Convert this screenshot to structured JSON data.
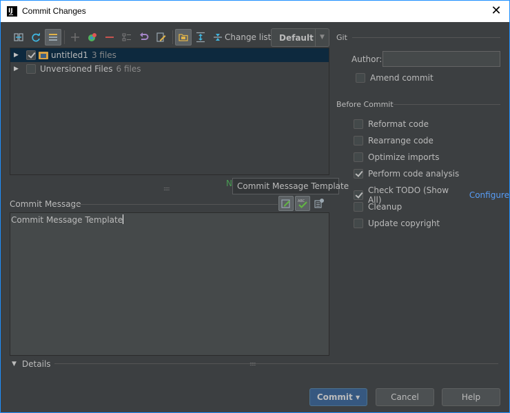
{
  "window": {
    "title": "Commit Changes",
    "app_icon": "intellij-icon",
    "close_icon": "close-icon"
  },
  "toolbar": {
    "buttons": [
      {
        "icon": "show-diff-icon"
      },
      {
        "icon": "refresh-icon"
      },
      {
        "icon": "group-by-directory-icon",
        "active": true
      },
      {
        "icon": "add-icon"
      },
      {
        "icon": "move-to-changelist-icon"
      },
      {
        "icon": "remove-icon"
      },
      {
        "icon": "shelve-icon"
      },
      {
        "icon": "rollback-icon"
      },
      {
        "icon": "edit-source-icon"
      },
      {
        "icon": "show-directories-icon",
        "active": true
      },
      {
        "icon": "expand-all-icon"
      },
      {
        "icon": "collapse-all-icon"
      }
    ],
    "changelist_label": "Change list:",
    "changelist_value": "Default"
  },
  "tree": {
    "rows": [
      {
        "name": "untitled1",
        "count": "3 files",
        "checked": true,
        "selected": true,
        "folder": true
      },
      {
        "name": "Unversioned Files",
        "count": "6 files",
        "checked": false,
        "selected": false,
        "folder": false
      }
    ]
  },
  "status_fragment": "N",
  "tooltip": "Commit Message Template",
  "commit_message": {
    "label": "Commit Message",
    "value": "Commit Message Template",
    "tools": [
      {
        "icon": "message-template-icon",
        "pressed": true
      },
      {
        "icon": "spellcheck-icon",
        "pressed": true
      },
      {
        "icon": "commit-history-icon",
        "pressed": false
      }
    ]
  },
  "details_label": "Details",
  "git": {
    "section_title": "Git",
    "author_label": "Author:",
    "author_value": "",
    "amend_label": "Amend commit",
    "amend_checked": false
  },
  "before_commit": {
    "section_title": "Before Commit",
    "options": [
      {
        "label": "Reformat code",
        "checked": false
      },
      {
        "label": "Rearrange code",
        "checked": false
      },
      {
        "label": "Optimize imports",
        "checked": false
      },
      {
        "label": "Perform code analysis",
        "checked": true
      },
      {
        "label": "Check TODO (Show All)",
        "checked": true,
        "link": "Configure"
      },
      {
        "label": "Cleanup",
        "checked": false
      },
      {
        "label": "Update copyright",
        "checked": false
      }
    ]
  },
  "buttons": {
    "commit": "Commit",
    "cancel": "Cancel",
    "help": "Help"
  }
}
